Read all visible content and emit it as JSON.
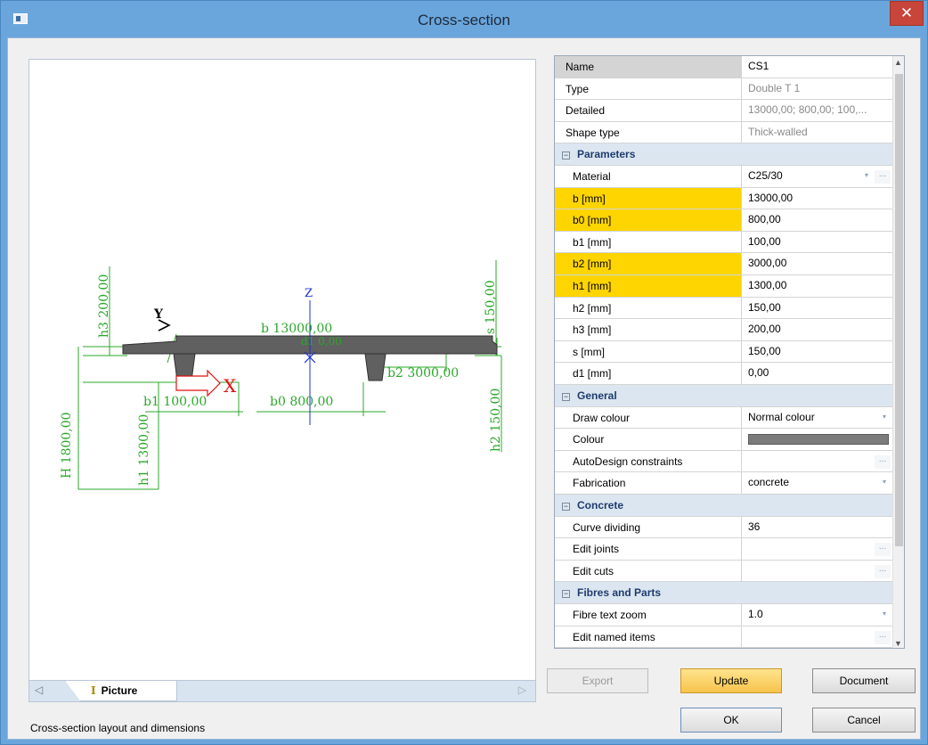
{
  "window": {
    "title": "Cross-section",
    "close_glyph": "✕",
    "status": "Cross-section layout and dimensions"
  },
  "tabs": {
    "picture_label": "Picture",
    "picture_icon": "I",
    "left_arrow": "◁",
    "right_arrow": "▷"
  },
  "drawing": {
    "axis_z": "Z",
    "axis_y": "Y",
    "axis_x": "X",
    "dim_b": "b 13000,00",
    "dim_d1": "d1 0,00",
    "dim_b1": "b1 100,00",
    "dim_b0": "b0 800,00",
    "dim_b2": "b2 3000,00",
    "dim_h3": "h3 200,00",
    "dim_H": "H 1800,00",
    "dim_h1": "h1 1300,00",
    "dim_s": "s 150,00",
    "dim_h2": "h2 150,00"
  },
  "properties": {
    "rows": [
      {
        "label": "Name",
        "value": "CS1",
        "kind": "sel"
      },
      {
        "label": "Type",
        "value": "Double T 1",
        "kind": "gray"
      },
      {
        "label": "Detailed",
        "value": "13000,00; 800,00; 100,...",
        "kind": "gray"
      },
      {
        "label": "Shape type",
        "value": "Thick-walled",
        "kind": "gray"
      },
      {
        "label": "Parameters",
        "kind": "cat",
        "toggle": "−"
      },
      {
        "label": "Material",
        "value": "C25/30",
        "kind": "dd-ell"
      },
      {
        "label": "b [mm]",
        "value": "13000,00",
        "kind": "hl"
      },
      {
        "label": "b0 [mm]",
        "value": "800,00",
        "kind": "hl"
      },
      {
        "label": "b1 [mm]",
        "value": "100,00",
        "kind": "plain"
      },
      {
        "label": "b2 [mm]",
        "value": "3000,00",
        "kind": "hl"
      },
      {
        "label": "h1 [mm]",
        "value": "1300,00",
        "kind": "hl"
      },
      {
        "label": "h2 [mm]",
        "value": "150,00",
        "kind": "plain"
      },
      {
        "label": "h3 [mm]",
        "value": "200,00",
        "kind": "plain"
      },
      {
        "label": "s [mm]",
        "value": "150,00",
        "kind": "plain"
      },
      {
        "label": "d1 [mm]",
        "value": "0,00",
        "kind": "plain"
      },
      {
        "label": "General",
        "kind": "cat",
        "toggle": "−"
      },
      {
        "label": "Draw colour",
        "value": "Normal colour",
        "kind": "dd"
      },
      {
        "label": "Colour",
        "value": "",
        "kind": "colour"
      },
      {
        "label": "AutoDesign constraints",
        "value": "",
        "kind": "ell"
      },
      {
        "label": "Fabrication",
        "value": "concrete",
        "kind": "dd"
      },
      {
        "label": "Concrete",
        "kind": "cat",
        "toggle": "−"
      },
      {
        "label": "Curve dividing",
        "value": "36",
        "kind": "plain"
      },
      {
        "label": "Edit joints",
        "value": "",
        "kind": "ell"
      },
      {
        "label": "Edit cuts",
        "value": "",
        "kind": "ell"
      },
      {
        "label": "Fibres and Parts",
        "kind": "cat",
        "toggle": "−"
      },
      {
        "label": "Fibre text zoom",
        "value": "1.0",
        "kind": "dd"
      },
      {
        "label": "Edit named items",
        "value": "",
        "kind": "ell"
      }
    ],
    "dropdown_glyph": "▾",
    "ellipsis_glyph": "...",
    "scroll_up": "▲",
    "scroll_down": "▼"
  },
  "buttons": {
    "export": "Export",
    "update": "Update",
    "document": "Document",
    "ok": "OK",
    "cancel": "Cancel"
  },
  "colors": {
    "dimension": "#2aa82a",
    "axis_z": "#1a2fd0",
    "axis_x": "#e01010",
    "section_fill": "#606060",
    "highlight": "#ffd500"
  }
}
